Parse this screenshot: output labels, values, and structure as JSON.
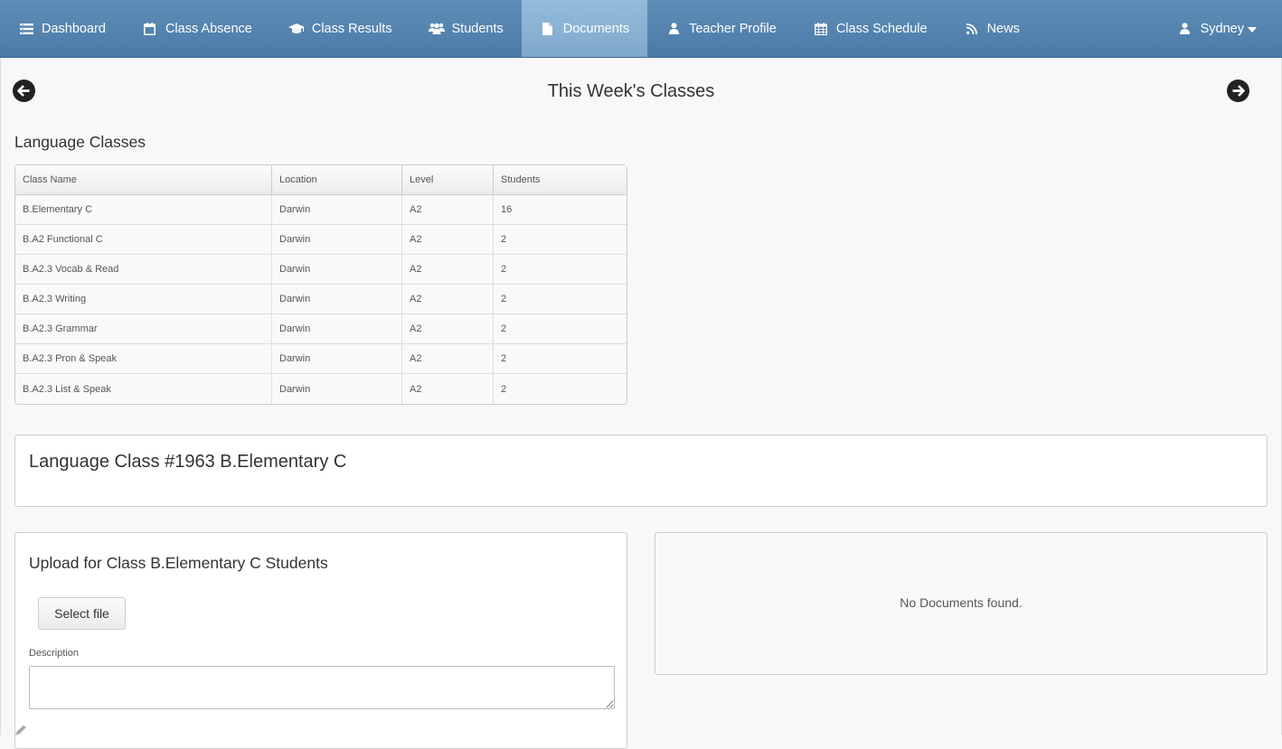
{
  "nav": {
    "items": [
      {
        "label": "Dashboard",
        "icon": "dashboard-icon"
      },
      {
        "label": "Class Absence",
        "icon": "calendar-icon"
      },
      {
        "label": "Class Results",
        "icon": "graduation-cap-icon"
      },
      {
        "label": "Students",
        "icon": "users-icon"
      },
      {
        "label": "Documents",
        "icon": "file-icon"
      },
      {
        "label": "Teacher Profile",
        "icon": "user-icon"
      },
      {
        "label": "Class Schedule",
        "icon": "calendar-grid-icon"
      },
      {
        "label": "News",
        "icon": "rss-icon"
      }
    ],
    "active": "Documents",
    "user": "Sydney",
    "colors": {
      "bar": "#5584b0",
      "active": "#8db5d4",
      "text": "#ffffff"
    }
  },
  "week": {
    "title": "This Week's Classes"
  },
  "classes": {
    "section_title": "Language Classes",
    "columns": [
      "Class Name",
      "Location",
      "Level",
      "Students"
    ],
    "rows": [
      [
        "B.Elementary C",
        "Darwin",
        "A2",
        "16"
      ],
      [
        "B.A2 Functional C",
        "Darwin",
        "A2",
        "2"
      ],
      [
        "B.A2.3 Vocab & Read",
        "Darwin",
        "A2",
        "2"
      ],
      [
        "B.A2.3 Writing",
        "Darwin",
        "A2",
        "2"
      ],
      [
        "B.A2.3 Grammar",
        "Darwin",
        "A2",
        "2"
      ],
      [
        "B.A2.3 Pron & Speak",
        "Darwin",
        "A2",
        "2"
      ],
      [
        "B.A2.3 List & Speak",
        "Darwin",
        "A2",
        "2"
      ]
    ]
  },
  "class_panel": {
    "heading": "Language Class #1963 B.Elementary C"
  },
  "upload": {
    "heading": "Upload for Class B.Elementary C Students",
    "select_label": "Select file",
    "description_label": "Description",
    "description_value": ""
  },
  "documents": {
    "empty_text": "No Documents found."
  }
}
